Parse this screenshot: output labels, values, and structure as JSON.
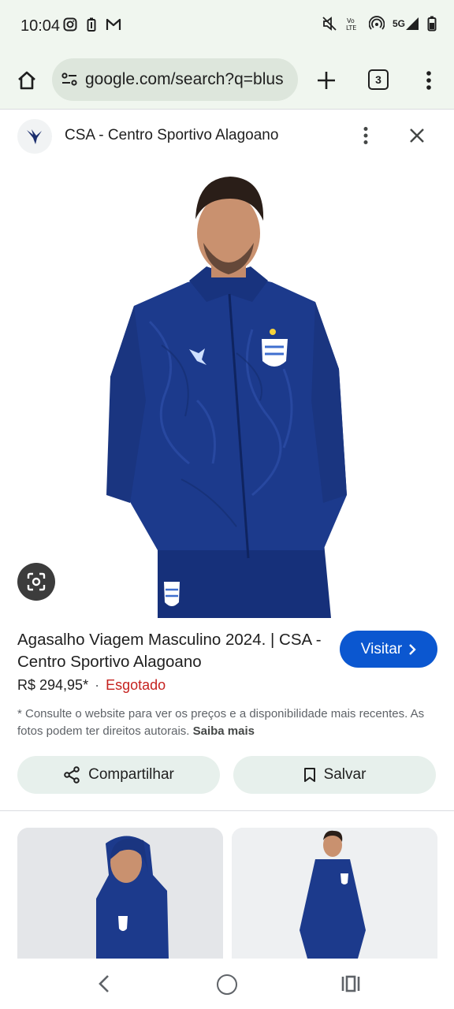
{
  "status_bar": {
    "time": "10:04",
    "network": "5G",
    "icons": [
      "instagram-icon",
      "battery-saver-icon",
      "gmail-icon",
      "mute-icon",
      "volte-icon",
      "hotspot-icon",
      "signal-icon",
      "battery-icon"
    ]
  },
  "browser": {
    "url": "google.com/search?q=blus",
    "tab_count": "3"
  },
  "site": {
    "name": "CSA - Centro Sportivo Alagoano"
  },
  "product": {
    "title": "Agasalho Viagem Masculino 2024. | CSA - Centro Sportivo Alagoano",
    "price": "R$ 294,95*",
    "separator": "·",
    "stock_status": "Esgotado",
    "visit_label": "Visitar",
    "disclaimer": "* Consulte o website para ver os preços e a disponibilidade mais recentes. As fotos podem ter direitos autorais.",
    "learn_more": "Saiba mais"
  },
  "actions": {
    "share_label": "Compartilhar",
    "save_label": "Salvar"
  },
  "colors": {
    "accent": "#0b57d0",
    "out_of_stock": "#c5221f",
    "jacket": "#1c3a8c",
    "chrome_bg": "#f0f6ef"
  }
}
